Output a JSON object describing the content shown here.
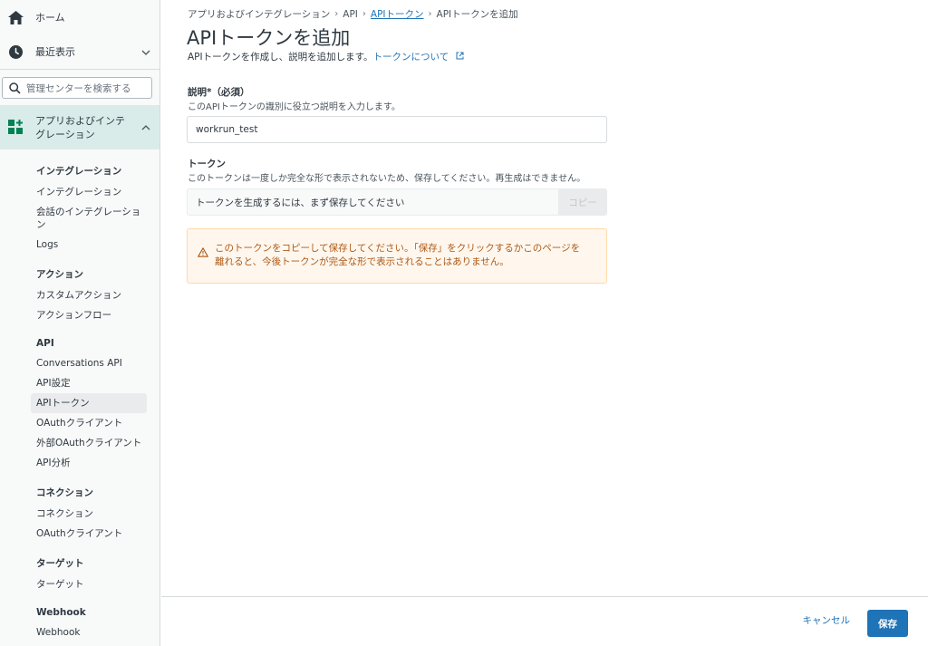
{
  "sidebar": {
    "home_label": "ホーム",
    "recent_label": "最近表示",
    "search_placeholder": "管理センターを検索する",
    "apps_label": "アプリおよびインテグレーション",
    "sections": [
      {
        "heading": "インテグレーション",
        "items": [
          "インテグレーション",
          "会話のインテグレーション",
          "Logs"
        ]
      },
      {
        "heading": "アクション",
        "items": [
          "カスタムアクション",
          "アクションフロー"
        ]
      },
      {
        "heading": "API",
        "items": [
          "Conversations API",
          "API設定",
          "APIトークン",
          "OAuthクライアント",
          "外部OAuthクライアント",
          "API分析"
        ]
      },
      {
        "heading": "コネクション",
        "items": [
          "コネクション",
          "OAuthクライアント"
        ]
      },
      {
        "heading": "ターゲット",
        "items": [
          "ターゲット"
        ]
      },
      {
        "heading": "Webhook",
        "items": [
          "Webhook"
        ]
      }
    ]
  },
  "breadcrumb": {
    "items": [
      "アプリおよびインテグレーション",
      "API",
      "APIトークン",
      "APIトークンを追加"
    ]
  },
  "page": {
    "title": "APIトークンを追加",
    "subtitle": "APIトークンを作成し、説明を追加します。",
    "subtitle_link": "トークンについて"
  },
  "form": {
    "description_label": "説明*（必須）",
    "description_hint": "このAPIトークンの識別に役立つ説明を入力します。",
    "description_value": "workrun_test",
    "token_label": "トークン",
    "token_hint": "このトークンは一度しか完全な形で表示されないため、保存してください。再生成はできません。",
    "token_placeholder": "トークンを生成するには、まず保存してください",
    "copy_label": "コピー"
  },
  "alert": {
    "line1": "このトークンをコピーして保存してください。「保存」をクリックするかこのページを",
    "line2": "離れると、今後トークンが完全な形で表示されることはありません。"
  },
  "footer": {
    "cancel_label": "キャンセル",
    "save_label": "保存"
  },
  "colors": {
    "accent": "#1f73b7",
    "active_nav": "#d9ece9",
    "warning_bg": "#fff7ed",
    "warning_text": "#ad5918"
  }
}
